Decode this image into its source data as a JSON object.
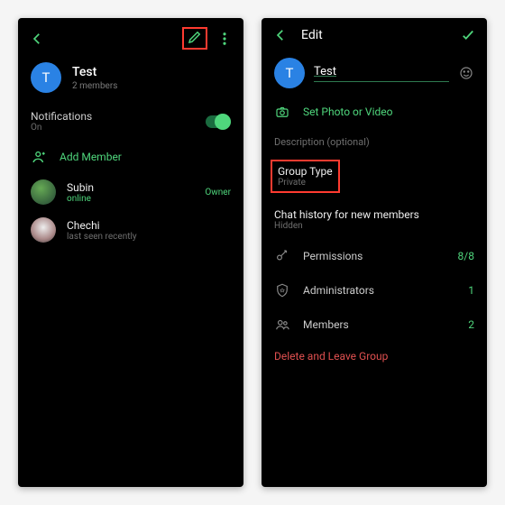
{
  "left": {
    "group_name": "Test",
    "members_count": "2 members",
    "avatar_letter": "T",
    "notifications_label": "Notifications",
    "notifications_status": "On",
    "add_member_label": "Add Member",
    "members": [
      {
        "name": "Subin",
        "status": "online",
        "status_color": "green",
        "role": "Owner"
      },
      {
        "name": "Chechi",
        "status": "last seen recently",
        "status_color": "grey",
        "role": ""
      }
    ]
  },
  "right": {
    "header_title": "Edit",
    "avatar_letter": "T",
    "group_name": "Test",
    "set_photo_label": "Set Photo or Video",
    "description_label": "Description (optional)",
    "group_type_label": "Group Type",
    "group_type_value": "Private",
    "chat_history_label": "Chat history for new members",
    "chat_history_value": "Hidden",
    "permissions_label": "Permissions",
    "permissions_value": "8/8",
    "admins_label": "Administrators",
    "admins_value": "1",
    "members_label": "Members",
    "members_value": "2",
    "delete_label": "Delete and Leave Group"
  }
}
